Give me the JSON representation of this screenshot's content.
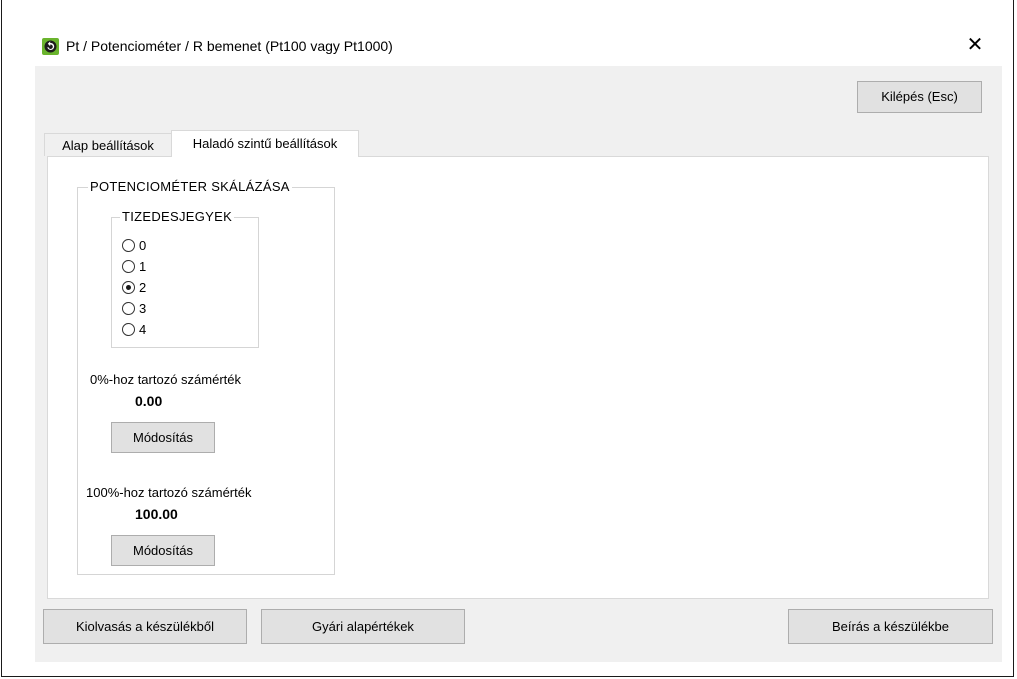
{
  "window": {
    "title": "Pt / Potenciométer / R bemenet (Pt100 vagy Pt1000)",
    "close_symbol": "✕",
    "icon": "app-logo-icon"
  },
  "toolbar": {
    "exit_label": "Kilépés (Esc)"
  },
  "tabs": [
    {
      "label": "Alap beállítások",
      "active": false
    },
    {
      "label": "Haladó szintű beállítások",
      "active": true
    }
  ],
  "scaling_group": {
    "title": "POTENCIOMÉTER SKÁLÁZÁSA",
    "decimals": {
      "title": "TIZEDESJEGYEK",
      "options": [
        "0",
        "1",
        "2",
        "3",
        "4"
      ],
      "selected": "2"
    },
    "zero": {
      "label": "0%-hoz tartozó számérték",
      "value": "0.00",
      "button_label": "Módosítás"
    },
    "full": {
      "label": "100%-hoz tartozó számérték",
      "value": "100.00",
      "button_label": "Módosítás"
    }
  },
  "bottom_bar": {
    "read_label": "Kiolvasás a készülékből",
    "defaults_label": "Gyári alapértékek",
    "write_label": "Beírás a készülékbe"
  },
  "colors": {
    "client_bg": "#f0f0f0",
    "panel_bg": "#ffffff",
    "button_bg": "#e1e1e1",
    "icon_green": "#6ab42d"
  }
}
